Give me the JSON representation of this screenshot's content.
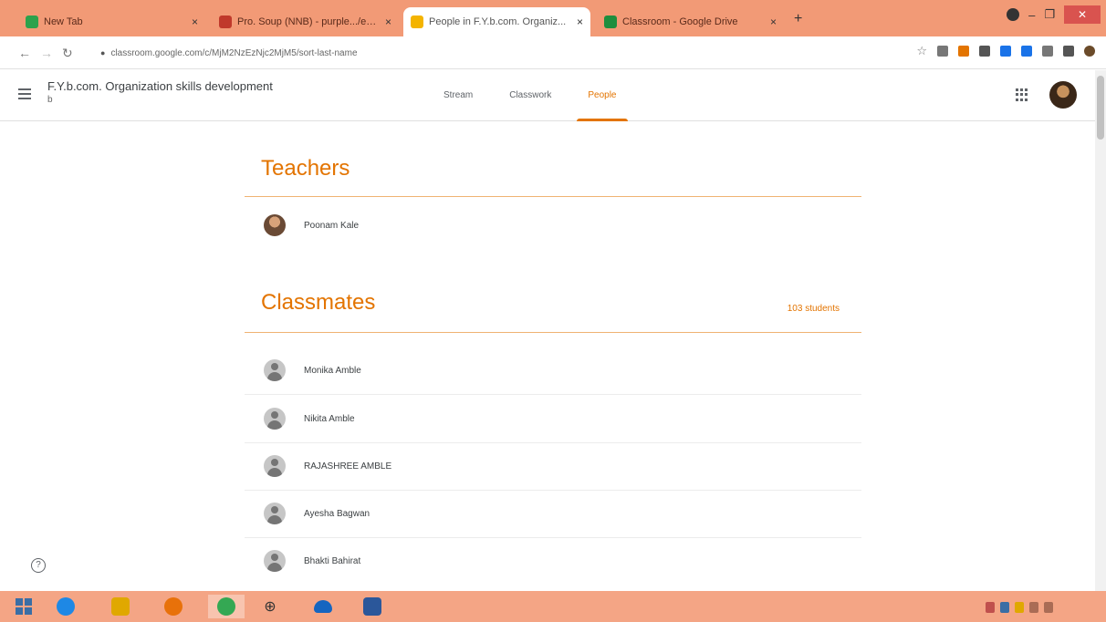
{
  "browser": {
    "tabs": [
      {
        "title": "New Tab",
        "color": "#2ca24c"
      },
      {
        "title": "Pro. Soup (NNB) - purple.../eelWE",
        "color": "#c0392b"
      },
      {
        "title": "People in F.Y.b.com. Organiz...",
        "color": "#f4b400"
      },
      {
        "title": "Classroom - Google Drive",
        "color": "#1e8e3e"
      }
    ],
    "url": "classroom.google.com/c/MjM2NzEzNjc2MjM5/sort-last-name",
    "extension_colors": [
      "#777777",
      "#e37400",
      "#555555",
      "#1a73e8",
      "#1a73e8",
      "#777777",
      "#555555",
      "#6b4b2a"
    ]
  },
  "header": {
    "class_title": "F.Y.b.com. Organization skills development",
    "class_subtitle": "b",
    "tabs": [
      "Stream",
      "Classwork",
      "People"
    ],
    "active_tab": "People"
  },
  "teachers": {
    "heading": "Teachers",
    "list": [
      {
        "name": "Poonam Kale"
      }
    ]
  },
  "classmates": {
    "heading": "Classmates",
    "count": "103 students",
    "list": [
      {
        "name": "Monika Amble"
      },
      {
        "name": "Nikita Amble"
      },
      {
        "name": "RAJASHREE AMBLE"
      },
      {
        "name": "Ayesha Bagwan"
      },
      {
        "name": "Bhakti Bahirat"
      }
    ]
  },
  "taskbar": {
    "icons": [
      "windows-start",
      "internet-explorer",
      "file-explorer",
      "firefox",
      "chrome",
      "magnifier",
      "cloud-app",
      "word"
    ],
    "icon_colors": [
      "#3a6ea5",
      "#1e88e5",
      "#e0a800",
      "#e8710a",
      "#34a853",
      "#555555",
      "#1565c0",
      "#2b579a"
    ]
  },
  "colors": {
    "accent": "#e37400",
    "tabstrip": "#f29a76",
    "taskbar": "#f4a585"
  }
}
